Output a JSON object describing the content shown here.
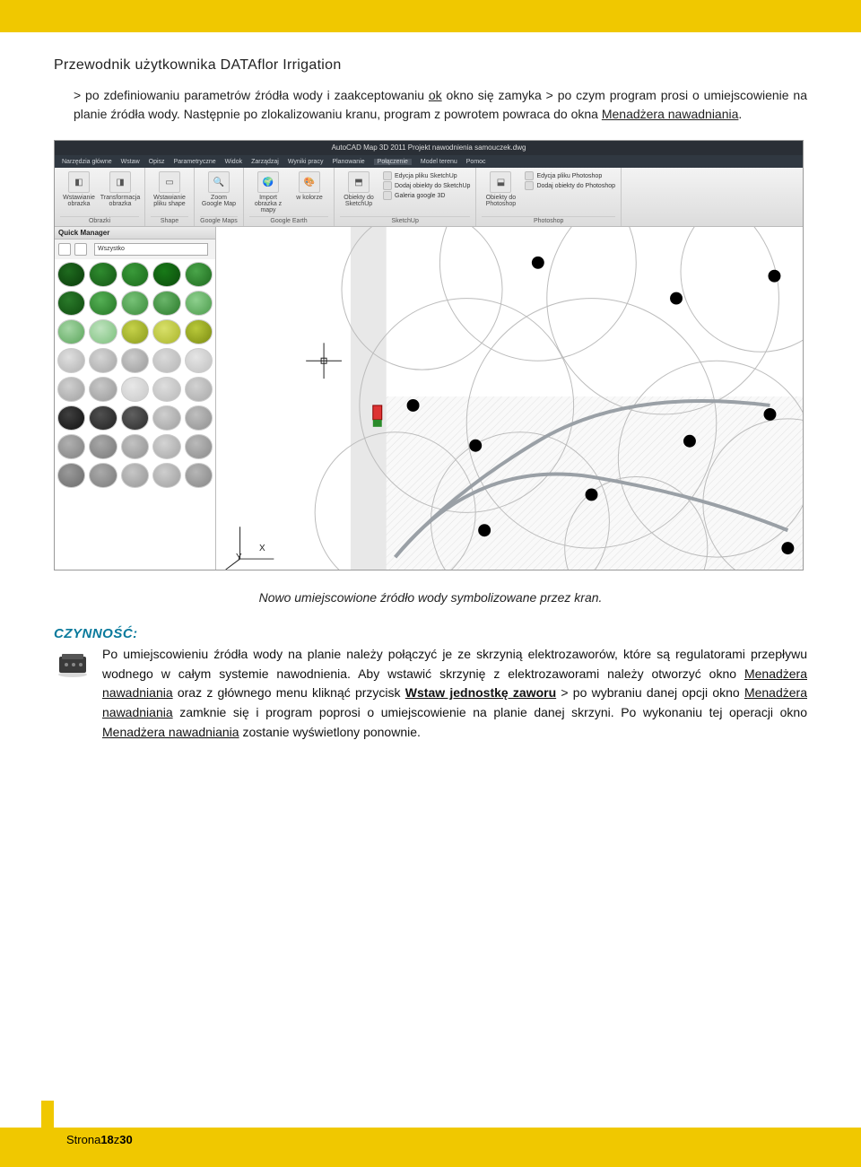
{
  "document": {
    "title": "Przewodnik użytkownika DATAflor Irrigation"
  },
  "intro": {
    "seg1": "> po zdefiniowaniu parametrów źródła wody i zaakceptowaniu ",
    "ok": "ok",
    "seg2": " okno się zamyka > po czym program prosi o umiejscowienie na planie źródła wody. Następnie po zlokalizowaniu kranu, program z powrotem powraca do okna ",
    "link": "Menadżera nawadniania",
    "seg3": "."
  },
  "screenshot": {
    "title": "AutoCAD Map 3D 2011   Projekt nawodnienia samouczek.dwg",
    "menu": [
      "Narzędzia główne",
      "Wstaw",
      "Opisz",
      "Parametryczne",
      "Widok",
      "Zarządzaj",
      "Wyniki pracy",
      "Planowanie",
      "Połączenie",
      "Model terenu",
      "Pomoc"
    ],
    "menu_active_index": 8,
    "ribbon": {
      "groups": [
        {
          "caption": "Obrazki",
          "icons": [
            {
              "glyph": "◧",
              "label": "Wstawianie obrazka"
            },
            {
              "glyph": "◨",
              "label": "Transformacja obrazka"
            }
          ]
        },
        {
          "caption": "Shape",
          "icons": [
            {
              "glyph": "▭",
              "label": "Wstawianie pliku shape"
            }
          ]
        },
        {
          "caption": "Google Maps",
          "icons": [
            {
              "glyph": "🔍",
              "label": "Zoom Google Map"
            }
          ]
        },
        {
          "caption": "Google Earth",
          "icons": [
            {
              "glyph": "🌍",
              "label": "Import obrazka z mapy"
            },
            {
              "glyph": "🎨",
              "label": "w kolorze"
            }
          ]
        },
        {
          "caption": "SketchUp",
          "icons": [
            {
              "glyph": "⬒",
              "label": "Obiekty do SketchUp"
            }
          ],
          "small": [
            "Edycja pliku SketchUp",
            "Dodaj obiekty do SketchUp",
            "Galeria google 3D"
          ]
        },
        {
          "caption": "Photoshop",
          "icons": [
            {
              "glyph": "⬓",
              "label": "Obiekty do Photoshop"
            }
          ],
          "small": [
            "Edycja pliku Photoshop",
            "Dodaj obiekty do Photoshop"
          ]
        }
      ]
    },
    "quick_manager": {
      "title": "Quick Manager",
      "dropdown": "Wszystko",
      "plants": [
        [
          "#1f6b1f",
          "#0a3a0a"
        ],
        [
          "#2f8b2f",
          "#145514"
        ],
        [
          "#3a9a3a",
          "#1a6a1a"
        ],
        [
          "#187a18",
          "#0c4a0c"
        ],
        [
          "#4aa54a",
          "#1e6a1e"
        ],
        [
          "#2a7a2a",
          "#0e4a0e"
        ],
        [
          "#55b055",
          "#237523"
        ],
        [
          "#77c277",
          "#3a8a3a"
        ],
        [
          "#6ab56a",
          "#2a7a2a"
        ],
        [
          "#8ed08e",
          "#4a9a4a"
        ],
        [
          "#a5d6a5",
          "#5aa55a"
        ],
        [
          "#bfe3bf",
          "#7abf7a"
        ],
        [
          "#c6d24a",
          "#8a9a1a"
        ],
        [
          "#d8e06a",
          "#aab52a"
        ],
        [
          "#b9c93a",
          "#7a8a10"
        ],
        [
          "#e0e0e0",
          "#b0b0b0"
        ],
        [
          "#d5d5d5",
          "#a5a5a5"
        ],
        [
          "#cccccc",
          "#9a9a9a"
        ],
        [
          "#dadada",
          "#b5b5b5"
        ],
        [
          "#e5e5e5",
          "#c0c0c0"
        ],
        [
          "#d0d0d0",
          "#a0a0a0"
        ],
        [
          "#c8c8c8",
          "#989898"
        ],
        [
          "#e8e8e8",
          "#c8c8c8"
        ],
        [
          "#dedede",
          "#b8b8b8"
        ],
        [
          "#d2d2d2",
          "#a8a8a8"
        ],
        [
          "#404040",
          "#101010"
        ],
        [
          "#505050",
          "#202020"
        ],
        [
          "#606060",
          "#2a2a2a"
        ],
        [
          "#cfcfcf",
          "#9f9f9f"
        ],
        [
          "#bfbfbf",
          "#8f8f8f"
        ],
        [
          "#b0b0b0",
          "#808080"
        ],
        [
          "#a8a8a8",
          "#787878"
        ],
        [
          "#c2c2c2",
          "#929292"
        ],
        [
          "#d4d4d4",
          "#a4a4a4"
        ],
        [
          "#bababa",
          "#8a8a8a"
        ],
        [
          "#9a9a9a",
          "#6a6a6a"
        ],
        [
          "#aaaaaa",
          "#7a7a7a"
        ],
        [
          "#c6c6c6",
          "#969696"
        ],
        [
          "#cecece",
          "#9e9e9e"
        ],
        [
          "#b6b6b6",
          "#868686"
        ]
      ]
    },
    "axes": {
      "y": "Y",
      "x": "X"
    }
  },
  "caption": "Nowo umiejscowione źródło wody symbolizowane przez kran.",
  "action": {
    "label": "CZYNNOŚĆ:",
    "seg1": "Po umiejscowieniu źródła wody na planie należy połączyć je ze skrzynią elektrozaworów, które są regulatorami przepływu wodnego w całym systemie nawodnienia. Aby wstawić skrzynię z elektrozaworami należy otworzyć okno ",
    "link1": "Menadżera nawadniania",
    "seg2": " oraz z głównego menu kliknąć przycisk ",
    "btn": "Wstaw jednostkę zaworu",
    "seg3": " > po wybraniu danej opcji okno ",
    "link2": "Menadżera nawadniania",
    "seg4": "  zamknie się i program poprosi o umiejscowienie na planie danej skrzyni. Po wykonaniu tej operacji okno ",
    "link3": "Menadżera nawadniania",
    "seg5": " zostanie wyświetlony ponownie."
  },
  "footer": {
    "prefix": "Strona ",
    "page": "18",
    "middle": " z ",
    "total": "30"
  }
}
